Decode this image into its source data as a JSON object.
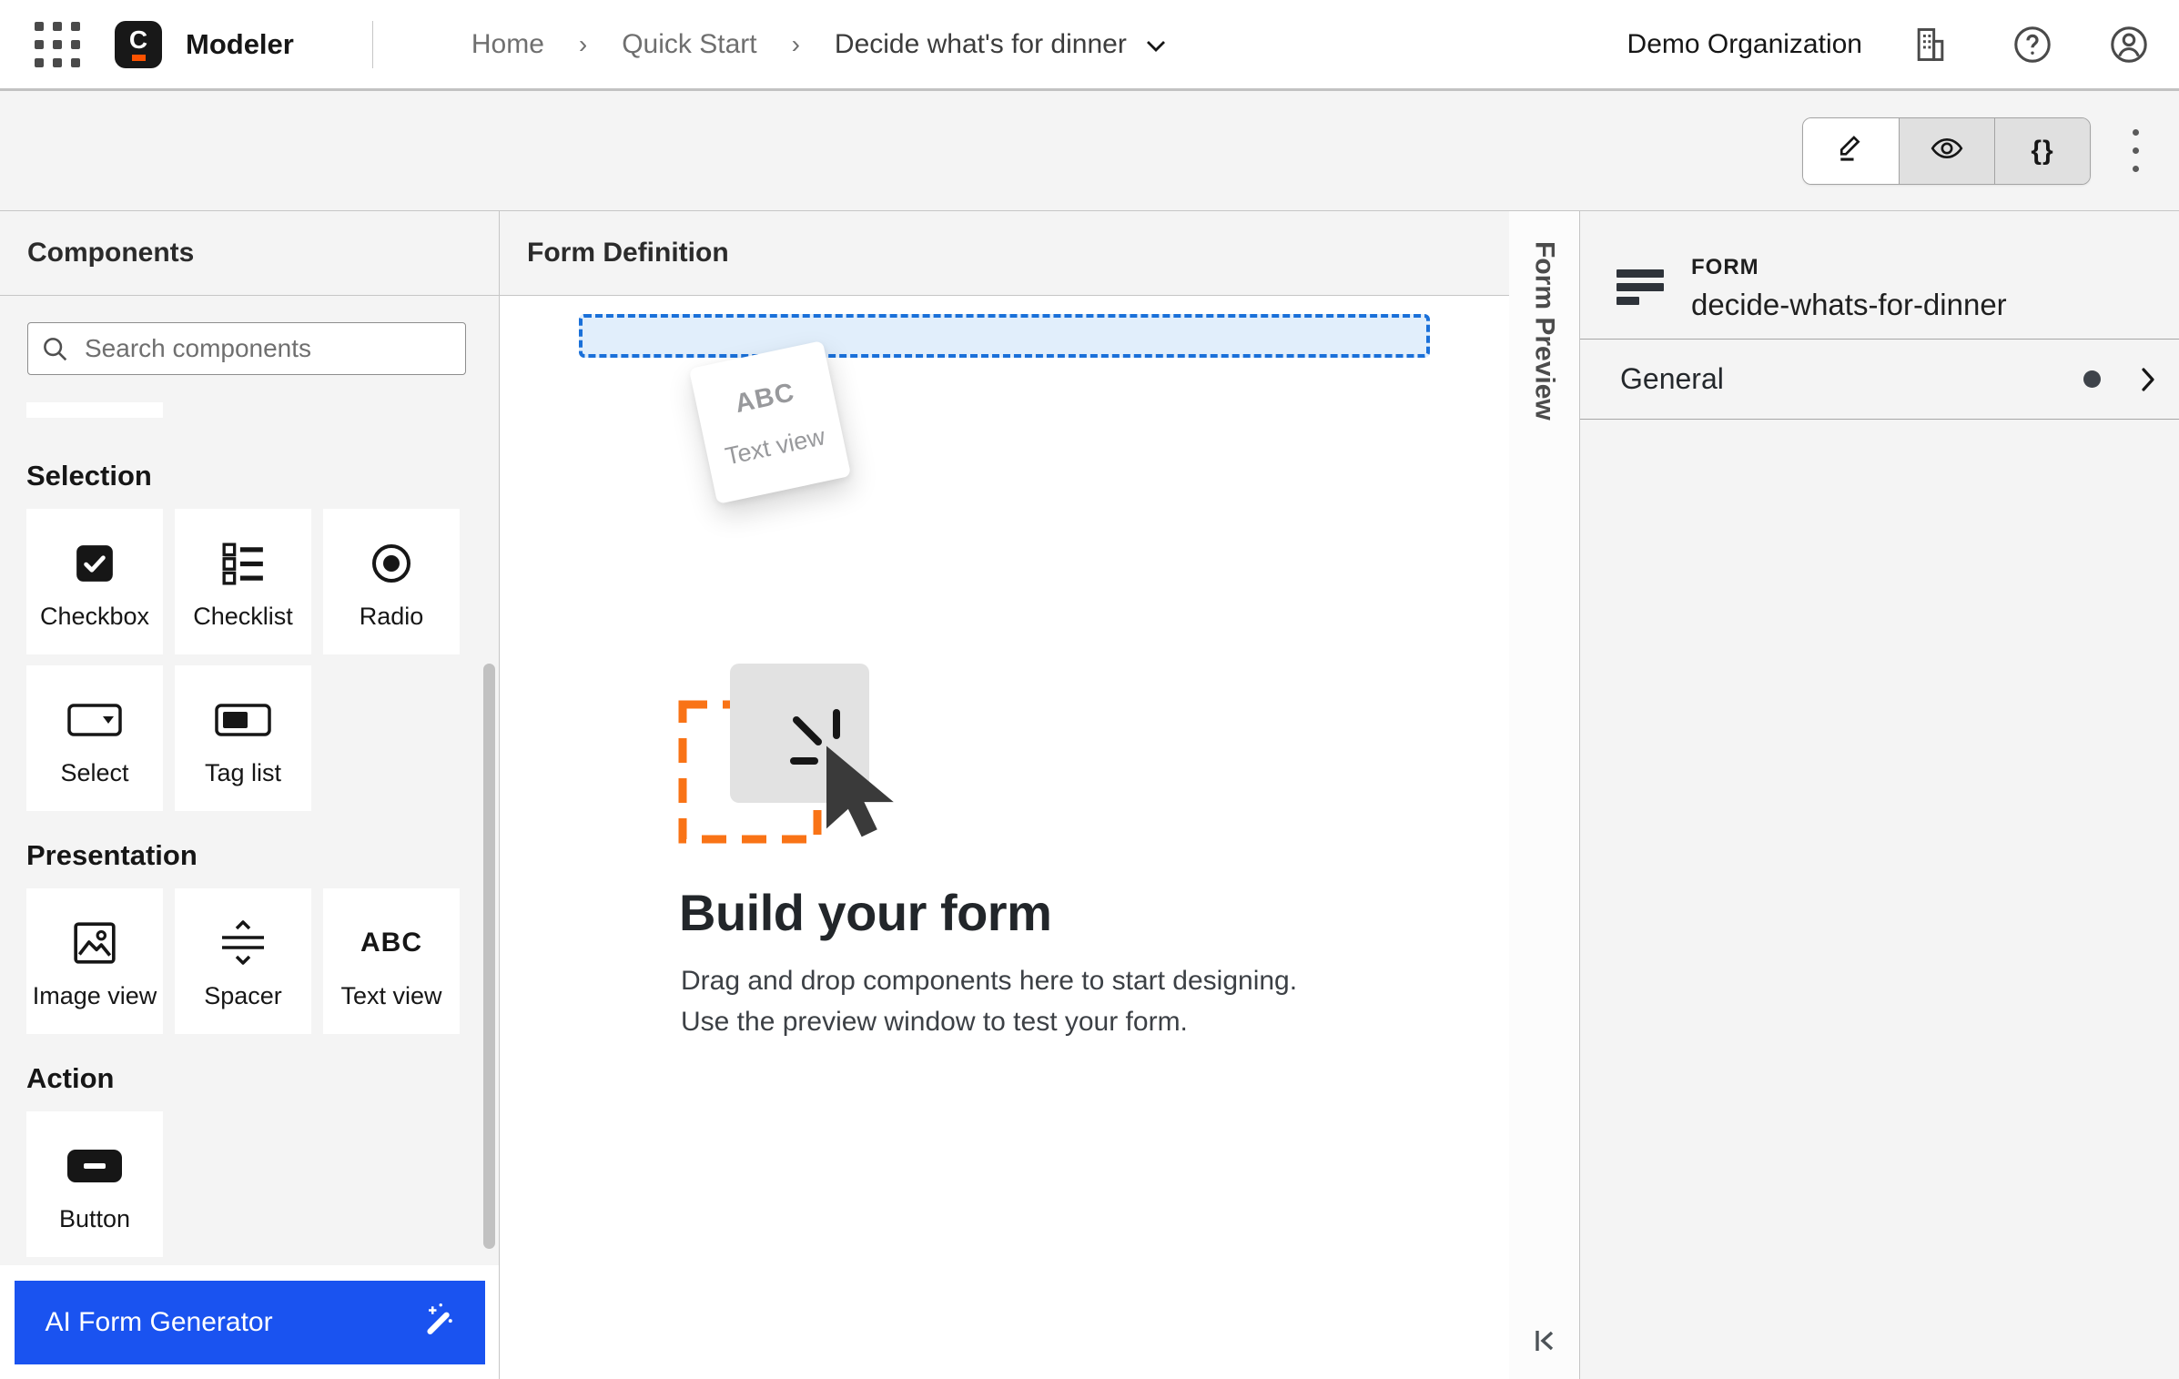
{
  "header": {
    "app_name": "Modeler",
    "breadcrumb": {
      "home": "Home",
      "parent": "Quick Start",
      "current": "Decide what's for dinner",
      "separator": "›"
    },
    "org_name": "Demo Organization"
  },
  "toolbar": {
    "code_label": "{}"
  },
  "components_panel": {
    "title": "Components",
    "search_placeholder": "Search components",
    "search_value": "",
    "sections": [
      {
        "title": "Selection",
        "items": [
          "Checkbox",
          "Checklist",
          "Radio",
          "Select",
          "Tag list"
        ]
      },
      {
        "title": "Presentation",
        "items": [
          "Image view",
          "Spacer",
          "Text view"
        ]
      },
      {
        "title": "Action",
        "items": [
          "Button"
        ]
      }
    ],
    "text_view_icon_text": "ABC",
    "ai_button_label": "AI Form Generator"
  },
  "canvas": {
    "title": "Form Definition",
    "drag_ghost": {
      "icon_text": "ABC",
      "label": "Text view"
    },
    "empty_state": {
      "heading": "Build your form",
      "line1": "Drag and drop components here to start designing.",
      "line2": "Use the preview window to test your form."
    }
  },
  "preview_strip": {
    "label": "Form Preview"
  },
  "properties_panel": {
    "type_label": "FORM",
    "form_id": "decide-whats-for-dinner",
    "general_label": "General"
  },
  "colors": {
    "accent_blue": "#1a53f0",
    "logo_orange": "#fc5200",
    "illustration_orange": "#f97316",
    "dropzone_border": "#1a70d9",
    "dropzone_fill": "#e1eefb"
  }
}
